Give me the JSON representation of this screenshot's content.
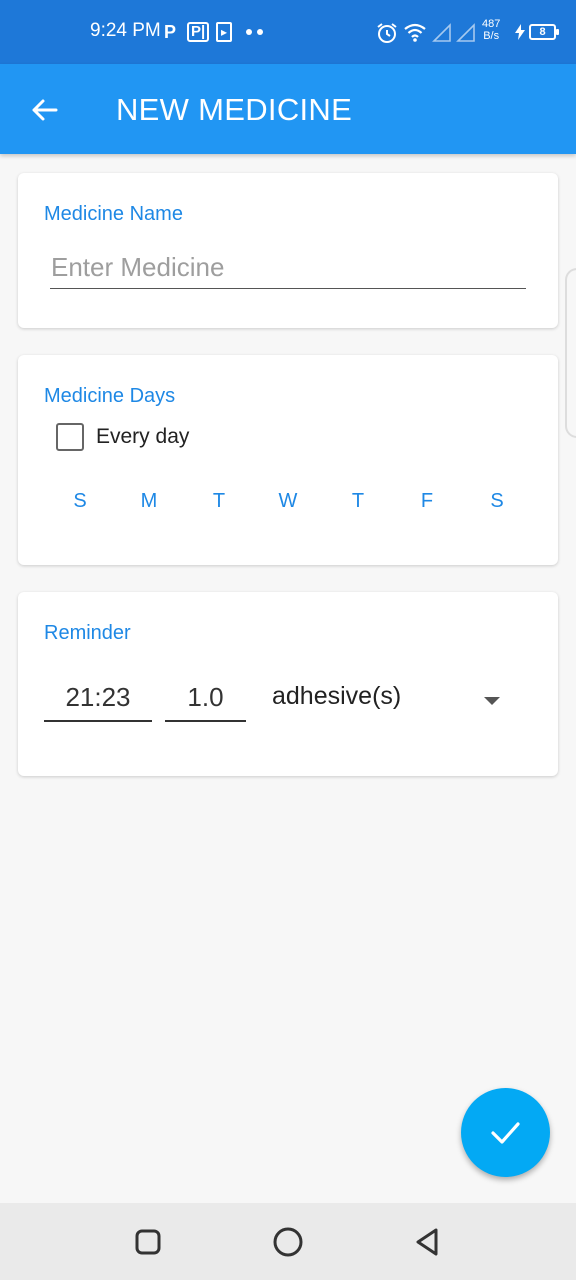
{
  "status_bar": {
    "time": "9:24 PM",
    "notification_icons": [
      "P",
      "P|",
      "▸"
    ],
    "network_speed_value": "487",
    "network_speed_unit": "B/s",
    "battery_level": "8"
  },
  "app_bar": {
    "title": "NEW MEDICINE"
  },
  "medicine_name": {
    "label": "Medicine Name",
    "placeholder": "Enter Medicine",
    "value": ""
  },
  "medicine_days": {
    "label": "Medicine Days",
    "every_day_label": "Every day",
    "every_day_checked": false,
    "days": [
      "S",
      "M",
      "T",
      "W",
      "T",
      "F",
      "S"
    ]
  },
  "reminder": {
    "label": "Reminder",
    "time": "21:23",
    "quantity": "1.0",
    "unit": "adhesive(s)"
  },
  "colors": {
    "status_bar": "#1e78d8",
    "app_bar": "#2196f3",
    "accent": "#1e88e5",
    "fab": "#03a9f4"
  },
  "icons": {
    "back": "arrow-left-icon",
    "fab": "check-icon",
    "nav": [
      "recents-square-icon",
      "home-circle-icon",
      "back-triangle-icon"
    ]
  }
}
